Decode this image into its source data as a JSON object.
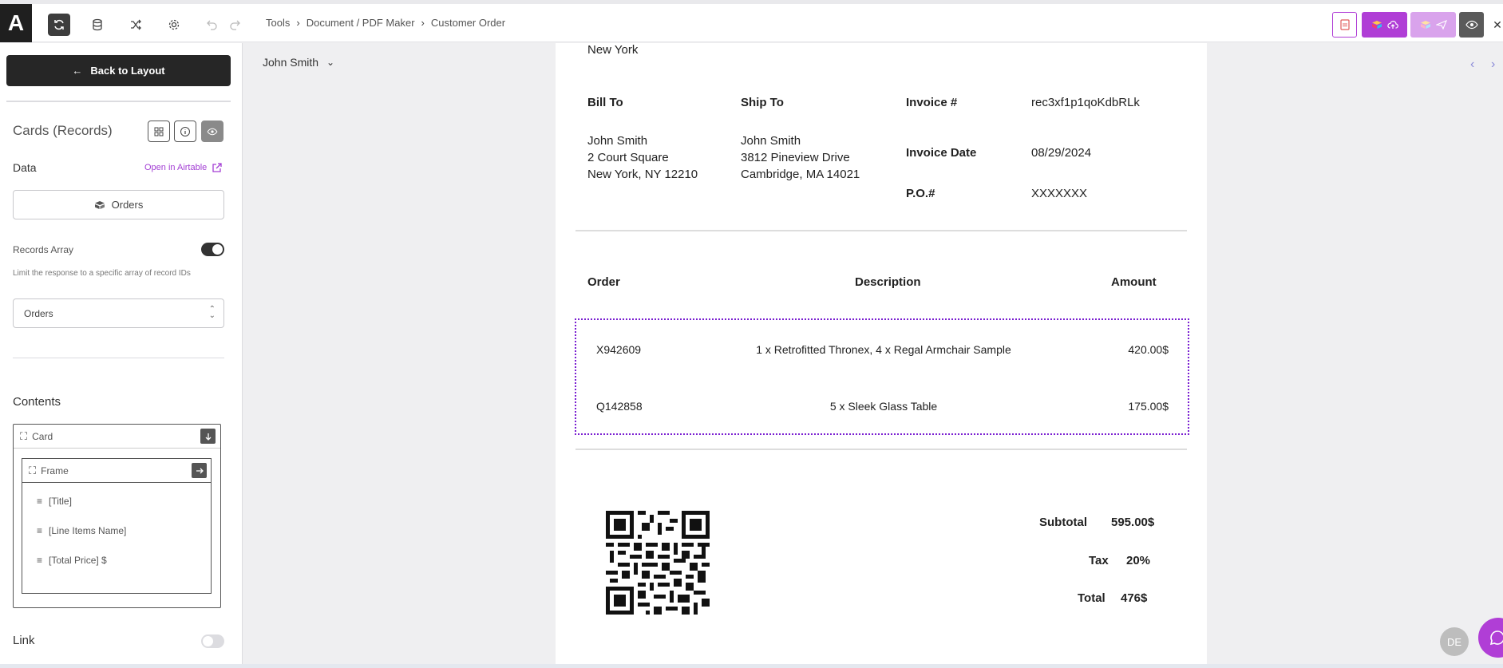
{
  "app": {
    "logo_glyph": "A"
  },
  "breadcrumbs": [
    "Tools",
    "Document / PDF Maker",
    "Customer Order"
  ],
  "left_panel": {
    "back_label": "Back to Layout",
    "section_title": "Cards (Records)",
    "data_label": "Data",
    "open_link": "Open in Airtable",
    "data_source": "Orders",
    "records_array_label": "Records Array",
    "records_array_on": true,
    "records_array_hint": "Limit the response to a specific array of record IDs",
    "records_select": "Orders",
    "contents_label": "Contents",
    "card_label": "Card",
    "frame_label": "Frame",
    "fields": [
      "[Title]",
      "[Line Items Name]",
      "[Total Price] $"
    ],
    "link_label": "Link",
    "link_on": false
  },
  "canvas": {
    "record_selector": "John Smith"
  },
  "document": {
    "city_top": "New York",
    "bill_to_label": "Bill To",
    "ship_to_label": "Ship To",
    "bill_to": [
      "John Smith",
      "2 Court Square",
      "New York, NY 12210"
    ],
    "ship_to": [
      "John Smith",
      "3812 Pineview Drive",
      "Cambridge, MA 14021"
    ],
    "invoice_num_label": "Invoice #",
    "invoice_num": "rec3xf1p1qoKdbRLk",
    "invoice_date_label": "Invoice Date",
    "invoice_date": "08/29/2024",
    "po_label": "P.O.#",
    "po_value": "XXXXXXX",
    "table_headers": {
      "order": "Order",
      "description": "Description",
      "amount": "Amount"
    },
    "items": [
      {
        "order": "X942609",
        "description": "1 x Retrofitted Thronex, 4 x Regal Armchair Sample",
        "amount": "420.00$"
      },
      {
        "order": "Q142858",
        "description": "5 x Sleek Glass Table",
        "amount": "175.00$"
      }
    ],
    "subtotal_label": "Subtotal",
    "subtotal": "595.00$",
    "tax_label": "Tax",
    "tax": "20%",
    "total_label": "Total",
    "total": "476$"
  },
  "user": {
    "initials": "DE"
  },
  "colors": {
    "accent_purple": "#b03ed6",
    "dark": "#262626",
    "selection": "#7a1fd1"
  }
}
